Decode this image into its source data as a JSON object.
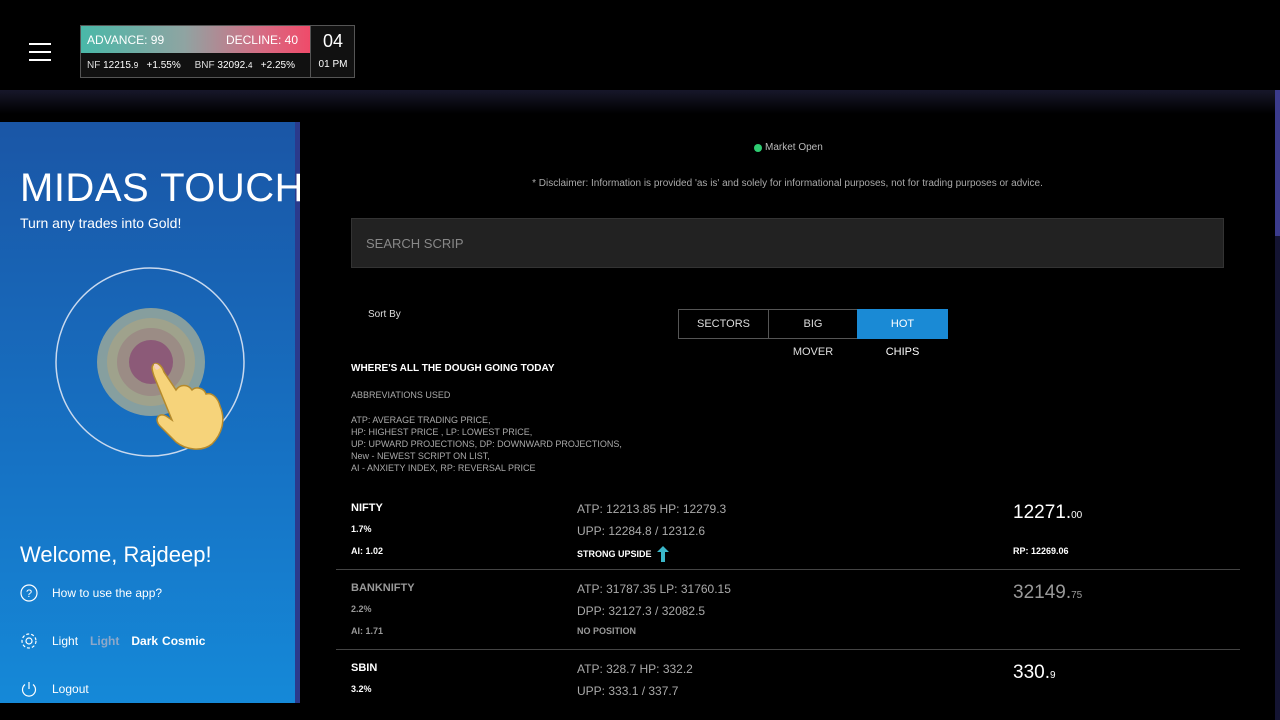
{
  "header": {
    "advance": "ADVANCE: 99",
    "decline": "DECLINE: 40",
    "nf_label": "NF",
    "nf_value_main": "12215.",
    "nf_value_dec": "9",
    "nf_change": "+1.55%",
    "bnf_label": "BNF",
    "bnf_value_main": "32092.",
    "bnf_value_dec": "4",
    "bnf_change": "+2.25%",
    "clock_hour": "04",
    "clock_period": "01 PM"
  },
  "sidebar": {
    "brand": "MIDAS TOUCH",
    "tagline": "Turn any trades into Gold!",
    "welcome": "Welcome, Rajdeep!",
    "help": "How to use the app?",
    "theme_label": "Light",
    "theme_options": [
      "Light",
      "Dark",
      "Cosmic"
    ],
    "logout": "Logout"
  },
  "main": {
    "market_status": "Market Open",
    "disclaimer": "* Disclaimer: Information is provided 'as is' and solely for informational purposes, not for trading purposes or advice.",
    "search_placeholder": "SEARCH SCRIP",
    "sort_by": "Sort By",
    "sort_options": [
      "SECTORS",
      "BIG MOVER",
      "HOT CHIPS"
    ],
    "active_sort": "HOT CHIPS",
    "section_title": "WHERE'S ALL THE DOUGH GOING TODAY",
    "abbr_title": "ABBREVIATIONS USED",
    "abbr_lines": [
      "ATP: AVERAGE TRADING PRICE,",
      "HP: HIGHEST PRICE , LP: LOWEST PRICE,",
      "UP: UPWARD PROJECTIONS, DP: DOWNWARD PROJECTIONS,",
      "New - NEWEST SCRIPT ON LIST,",
      "AI - ANXIETY INDEX, RP: REVERSAL PRICE"
    ]
  },
  "rows": [
    {
      "name": "NIFTY",
      "pct": "1.7%",
      "ai": "AI: 1.02",
      "line1": "ATP: 12213.85    HP: 12279.3",
      "line2": "UPP: 12284.8 / 12312.6",
      "signal": "STRONG UPSIDE",
      "price_main": "12271.",
      "price_dec": "00",
      "rp": "RP: 12269.06"
    },
    {
      "name": "BANKNIFTY",
      "pct": "2.2%",
      "ai": "AI: 1.71",
      "line1": "ATP: 31787.35    LP: 31760.15",
      "line2": "DPP: 32127.3 / 32082.5",
      "signal": "NO POSITION",
      "price_main": "32149.",
      "price_dec": "75"
    },
    {
      "name": "SBIN",
      "pct": "3.2%",
      "line1": "ATP: 328.7    HP: 332.2",
      "line2": "UPP: 333.1 / 337.7",
      "price_main": "330.",
      "price_dec": "9"
    }
  ]
}
